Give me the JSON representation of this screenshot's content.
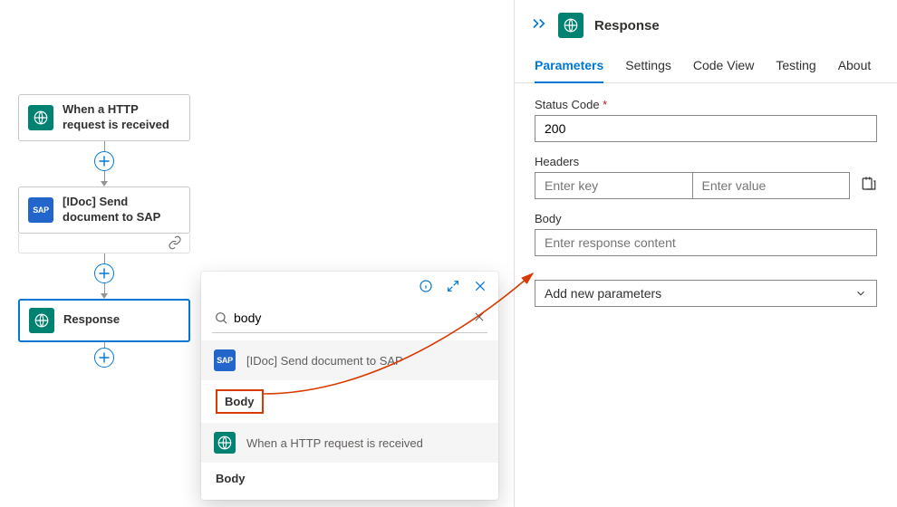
{
  "designer": {
    "nodes": [
      {
        "kind": "response",
        "label": "When a HTTP request is received"
      },
      {
        "kind": "sap",
        "label": "[IDoc] Send document to SAP"
      },
      {
        "kind": "response",
        "label": "Response"
      }
    ]
  },
  "picker": {
    "search_value": "body",
    "groups": [
      {
        "kind": "sap",
        "header": "[IDoc] Send document to SAP",
        "items": [
          "Body"
        ],
        "highlight": true
      },
      {
        "kind": "response",
        "header": "When a HTTP request is received",
        "items": [
          "Body"
        ],
        "highlight": false
      }
    ]
  },
  "panel": {
    "title": "Response",
    "tabs": [
      "Parameters",
      "Settings",
      "Code View",
      "Testing",
      "About"
    ],
    "active_tab": 0,
    "fields": {
      "status_label": "Status Code",
      "status_value": "200",
      "headers_label": "Headers",
      "headers_key_placeholder": "Enter key",
      "headers_val_placeholder": "Enter value",
      "body_label": "Body",
      "body_placeholder": "Enter response content",
      "addparam_label": "Add new parameters"
    }
  }
}
